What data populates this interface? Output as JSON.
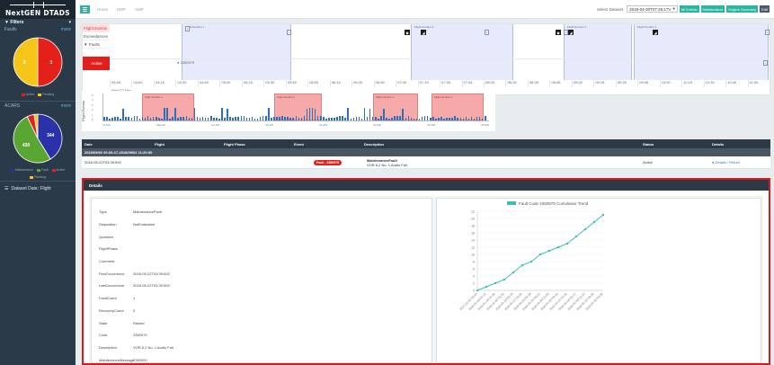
{
  "app": {
    "logo_text": "NextGEN DTADS"
  },
  "sidebar": {
    "filters_label": "Filters",
    "faults_label": "Faults",
    "faults_link": "more",
    "faults_pie": {
      "values": [
        3,
        3
      ],
      "colors": [
        "#e5201b",
        "#f5c518"
      ],
      "labels": [
        "3",
        "3"
      ]
    },
    "faults_legend": [
      "Active",
      "Pending"
    ],
    "acars_label": "ACARS",
    "acars_link": "more",
    "acars_pie": {
      "values": [
        344,
        430,
        40,
        20
      ],
      "colors": [
        "#2b31a8",
        "#5aa632",
        "#e5201b",
        "#f5c518"
      ],
      "labels": [
        "344",
        "430"
      ]
    },
    "acars_legend": [
      "Maintenance",
      "Fault",
      "Active",
      "Pending"
    ],
    "dataset_item": "Dataset Date: Flight"
  },
  "topbar": {
    "nav": [
      "Home",
      "DMP",
      "AMP"
    ],
    "select_label": "Select Dataset",
    "select_value": "2018-04-30T07:25:17V",
    "buttons": [
      "All Events",
      "Maintenance",
      "Engine Summary",
      "Edit"
    ]
  },
  "timeline": {
    "rows": [
      "Flight Events",
      "Exceedances",
      "Faults",
      "Active"
    ],
    "band_labels": [
      "Flight Number 1",
      "Flight Number 2",
      "Flight Number 3",
      "Flight Number 4"
    ],
    "fault_code": "2350979",
    "axis_ticks": [
      "03:45",
      "04:00",
      "04:15",
      "04:30",
      "04:45",
      "05:00",
      "05:15",
      "05:30",
      "05:45",
      "06:00",
      "06:15",
      "06:30",
      "06:45",
      "07:00",
      "07:15",
      "07:30",
      "07:45",
      "08:00",
      "08:15",
      "08:30",
      "08:45",
      "09:00",
      "09:15",
      "09:30",
      "09:45",
      "10:00",
      "10:15",
      "10:30",
      "10:45",
      "11:00"
    ],
    "date": "Wed 02 May"
  },
  "histogram": {
    "ylabel": "Flight Events",
    "flight_labels": [
      "Flight Number 1",
      "Flight Number 2",
      "Flight Number 3",
      "Flight Number 4"
    ],
    "x_ticks": [
      "11 PM",
      "May 02",
      "01 AM",
      "02 AM",
      "03 AM",
      "04 AM",
      "05 AM",
      "06 AM"
    ],
    "y_ticks": [
      "5",
      "4",
      "3",
      "2",
      "1",
      "0"
    ]
  },
  "table": {
    "headers": [
      "Date",
      "Flight",
      "Flight Phase",
      "Event",
      "Description",
      "Status",
      "Details"
    ],
    "group_label": "2018/05/02 00:20:17-2018/05/02 11:20:00",
    "rows": [
      {
        "date": "2018-05-22T03:39:59Z",
        "flight": "",
        "phase": "",
        "event": "Fault - 2350979",
        "desc_line1": "MaintenanceFault",
        "desc_line2": "VOR 6.2 No. 1 Audio Fail",
        "status": "Active",
        "details": "Details / Return"
      }
    ]
  },
  "details": {
    "header": "Details",
    "fields": [
      {
        "key": "Type",
        "value": "MaintenanceFault"
      },
      {
        "key": "Disposition",
        "value": "NotEvaluated"
      },
      {
        "key": "Question",
        "value": ""
      },
      {
        "key": "FlightPhase",
        "value": ""
      },
      {
        "key": "Comment",
        "value": ""
      },
      {
        "key": "FirstOccurrence",
        "value": "2018-05-22T03:39:59Z"
      },
      {
        "key": "LastOccurrence",
        "value": "2018-05-22T03:39:59Z"
      },
      {
        "key": "FaultCount",
        "value": "1"
      },
      {
        "key": "RecoveryCount",
        "value": "0"
      },
      {
        "key": "State",
        "value": "Raised"
      },
      {
        "key": "Code",
        "value": "2350979"
      },
      {
        "key": "Description",
        "value": "VOR 6.2 No. 1 Audio Fail"
      },
      {
        "key": "MaintenanceMessage",
        "value": "2350000"
      }
    ]
  },
  "chart_data": {
    "type": "line",
    "legend": "Fault Code 2350979 Cumulative Trend",
    "series": [
      {
        "name": "Fault Code 2350979 Cumulative Trend",
        "color": "#3cbfb2",
        "values": [
          0,
          1,
          2,
          3,
          5,
          7,
          8,
          10,
          11,
          12,
          13,
          15,
          17,
          19,
          21
        ]
      }
    ],
    "categories": [
      "2017-12-21T18:49",
      "2018-01-04T05:12",
      "2018-01-18T21:40",
      "2018-02-02T11:05",
      "2018-02-14T06:33",
      "2018-02-27T19:20",
      "2018-03-10T02:48",
      "2018-03-19T08:15",
      "2018-03-28T14:02",
      "2018-04-06T09:44",
      "2018-04-15T16:30",
      "2018-04-24T01:57",
      "2018-05-03T11:12",
      "2018-05-12T20:39",
      "2018-05-22T03:39"
    ],
    "y_ticks": [
      "0",
      "2",
      "4",
      "6",
      "8",
      "10",
      "12",
      "14",
      "16",
      "18",
      "20",
      "22"
    ],
    "ylim": [
      0,
      22
    ]
  }
}
